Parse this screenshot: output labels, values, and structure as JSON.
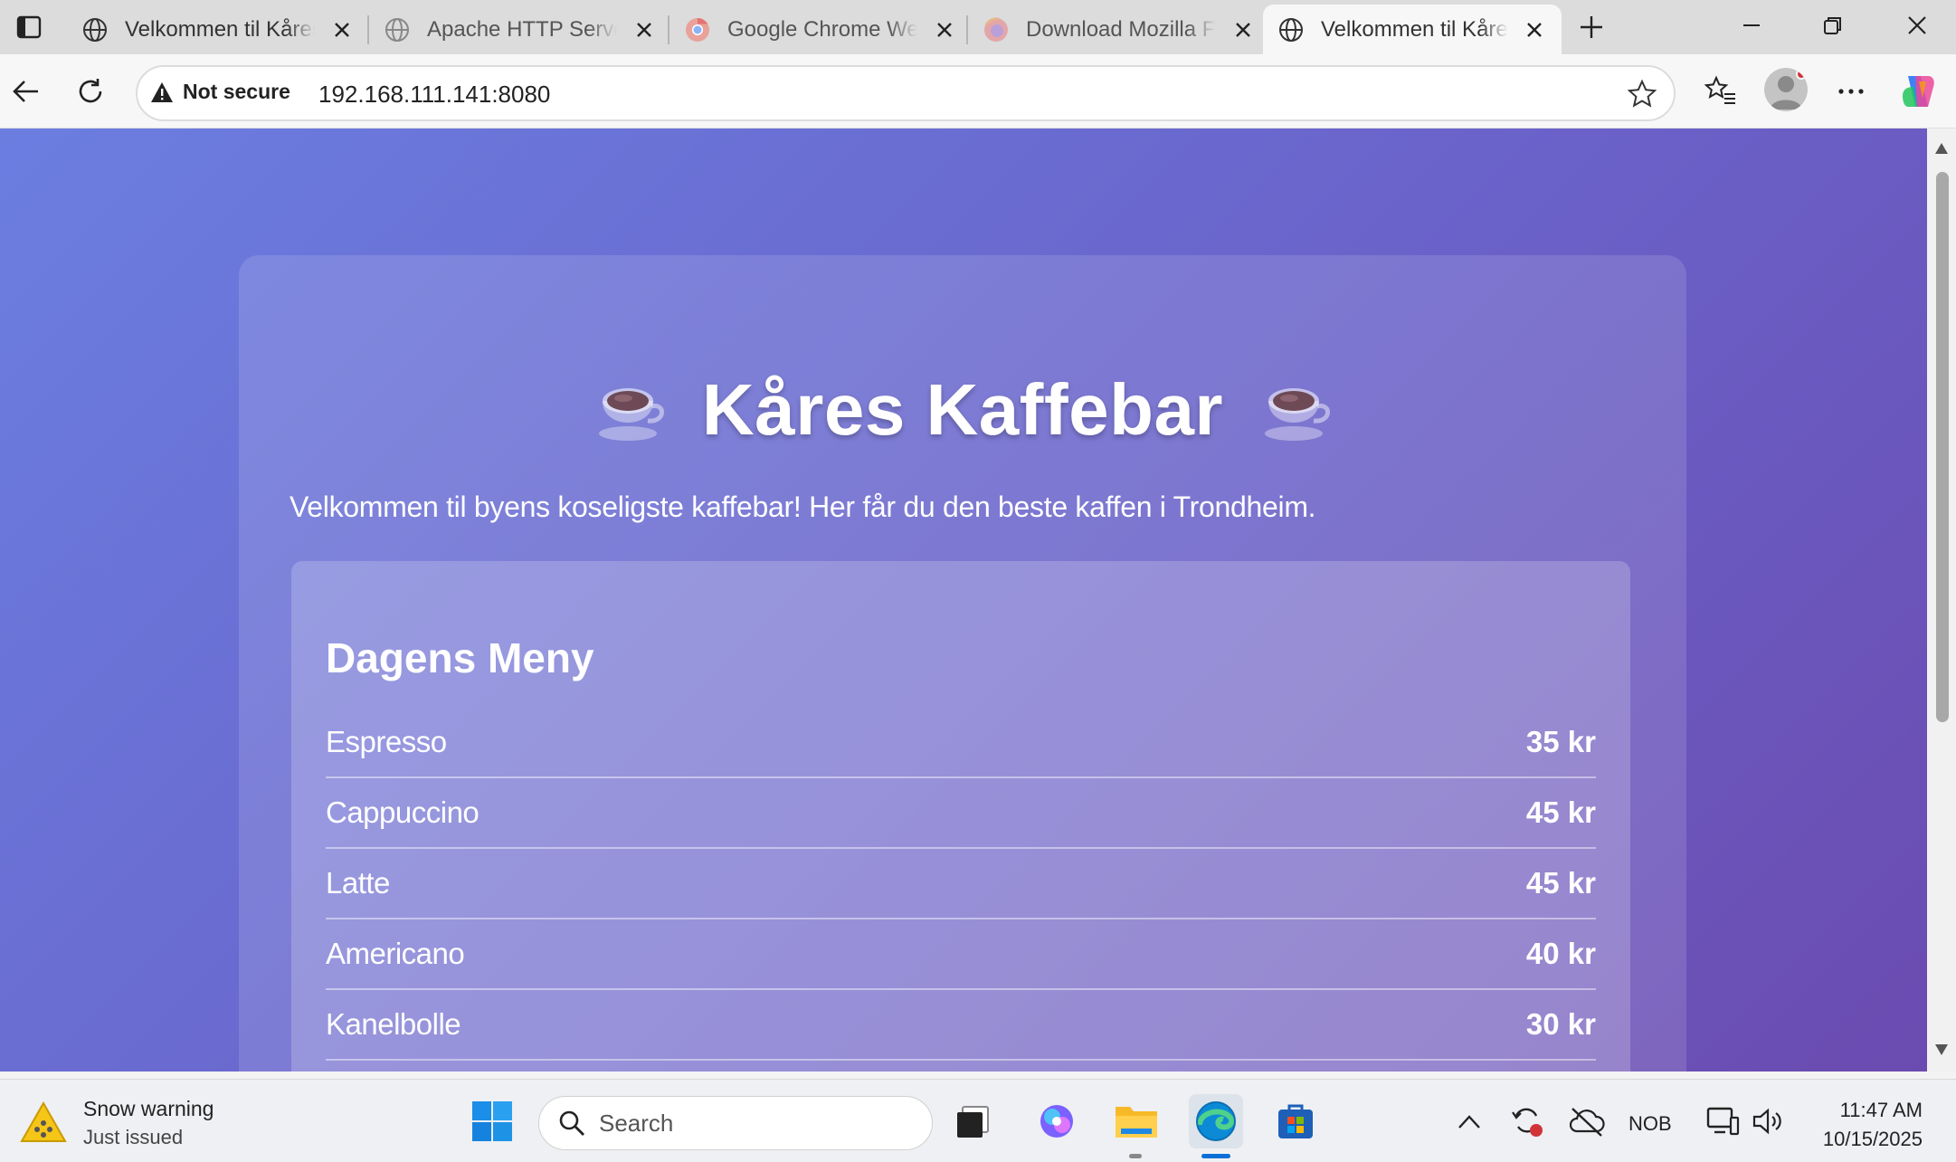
{
  "browser": {
    "tabs": [
      {
        "title": "Velkommen til Kåres Kaffebar",
        "favicon": "globe-icon",
        "active": false
      },
      {
        "title": "Apache HTTP Server Test Page",
        "favicon": "globe-icon",
        "active": false
      },
      {
        "title": "Google Chrome Web Browser",
        "favicon": "chrome-icon",
        "active": false
      },
      {
        "title": "Download Mozilla Firefox",
        "favicon": "firefox-icon",
        "active": false
      },
      {
        "title": "Velkommen til Kåres Kaffebar",
        "favicon": "globe-icon",
        "active": true
      }
    ],
    "security_label": "Not secure",
    "url": "192.168.111.141:8080"
  },
  "page": {
    "title": "Kåres Kaffebar",
    "tagline": "Velkommen til byens koseligste kaffebar! Her får du den beste kaffen i Trondheim.",
    "menu": {
      "heading": "Dagens Meny",
      "items": [
        {
          "name": "Espresso",
          "price": "35 kr"
        },
        {
          "name": "Cappuccino",
          "price": "45 kr"
        },
        {
          "name": "Latte",
          "price": "45 kr"
        },
        {
          "name": "Americano",
          "price": "40 kr"
        },
        {
          "name": "Kanelbolle",
          "price": "30 kr"
        }
      ]
    }
  },
  "taskbar": {
    "weather": {
      "title": "Snow warning",
      "subtitle": "Just issued",
      "icon": "snow-warning-icon"
    },
    "search_placeholder": "Search",
    "language": "NOB",
    "time": "11:47 AM",
    "date": "10/15/2025"
  },
  "colors": {
    "page_gradient_start": "#6b7ee0",
    "page_gradient_end": "#6b4bb0",
    "tab_strip": "#dcdcdc",
    "taskbar": "#eef0f3"
  }
}
